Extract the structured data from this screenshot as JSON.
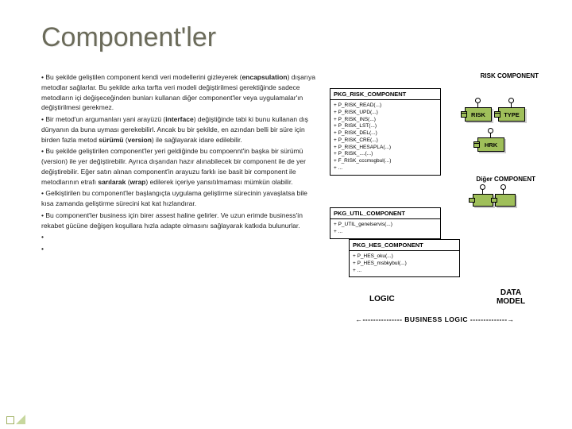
{
  "title": "Component'ler",
  "bullets": [
    "• Bu şekilde geliştilen component kendi veri modellerini gizleyerek (<b>encapsulation</b>) dışarıya metodlar sağlarlar. Bu şekilde arka tarfta veri modeli değiştirilmesi gerektiğinde sadece metodların içi değişeceğinden bunları kullanan diğer component'ler veya uygulamalar'ın değiştirilmesi gerekmez.",
    "• Bir metod'un argumanları yani arayüzü (<b>interface</b>) değiştiğinde tabi ki bunu kullanan dış dünyanın da buna uyması gerekebilirl. Ancak bu bir şekilde, en azından belli bir süre için birden fazla metod <b>sürümü</b> (<b>version</b>) ile sağlayarak idare edilebilir.",
    "• Bu şekilde geliştirilen component'ler yeri geldiğinde bu compoennt'in başka bir sürümü (version) ile yer değiştirebilir. Ayrıca dışarıdan hazır alınabilecek bir component ile de yer değiştirebilir. Eğer satın alınan component'in arayuzu farklı ise basit bir component ile metodlarının etrafı <b>sarılarak</b> (<b>wrap</b>) edilerek içeriye yansıtılmaması mümkün olabilir.",
    "• Gelkiştirilen bu component'ler başlangıçta uygulama geliştirme sürecinin yavaşlatsa bile kısa zamanda geliştirme sürecini kat kat hızlandırar.",
    "• Bu component'ler business için birer assest haline gelirler. Ve uzun erimde business'in rekabet gücüne değişen koşullara hızla adapte olmasını sağlayarak katkıda bulunurlar.",
    "•",
    "•"
  ],
  "risk_label": "RISK COMPONENT",
  "diger_label": "Diğer COMPONENT",
  "comp_boxes": {
    "risk": "RISK",
    "type": "TYPE",
    "hrk": "HRK"
  },
  "pkg_risk": {
    "head": "PKG_RISK_COMPONENT",
    "lines": [
      "+ P_RISK_READ(...)",
      "+ P_RISK_UPD(...)",
      "+ P_RISK_INS(...)",
      "+ P_RISK_LST(...)",
      "+ P_RISK_DEL(...)",
      "+ P_RISK_CRE(...)",
      "+ P_RISK_HESAPLA(...)",
      "+ P_RISK_....(...)",
      "+ F_RISK_cccmsgbul(...)",
      "+ ..."
    ]
  },
  "pkg_util": {
    "head": "PKG_UTIL_COMPONENT",
    "lines": [
      "+ P_UTIL_genelservis(...)",
      "+ ..."
    ]
  },
  "pkg_hes": {
    "head": "PKG_HES_COMPONENT",
    "lines": [
      "+ P_HES_oku(...)",
      "+ P_HES_msbkybul(...)",
      "+ ..."
    ]
  },
  "logic_label": "LOGIC",
  "dm_label": "DATA MODEL",
  "bl_label": "BUSINESS LOGIC"
}
